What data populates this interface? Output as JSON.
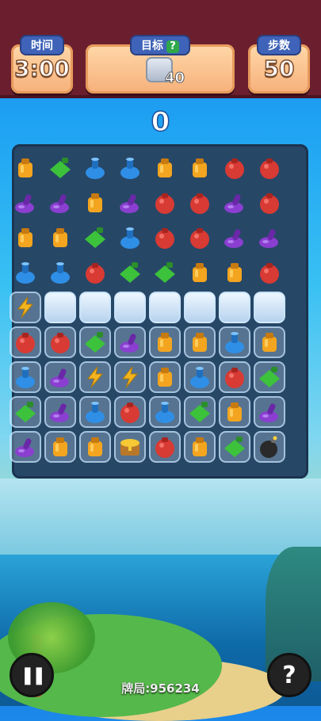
{
  "hud": {
    "time_label": "时间",
    "time_value": "3:00",
    "goal_label": "目标",
    "goal_help": "?",
    "goal_icon": "ice-block-icon",
    "goal_count": "40",
    "moves_label": "步数",
    "moves_value": "50"
  },
  "score": "0",
  "board": {
    "rows": [
      [
        "orange",
        "green",
        "blue",
        "blue",
        "orange",
        "orange",
        "red",
        "red"
      ],
      [
        "purple",
        "purple",
        "orange",
        "purple",
        "red",
        "red",
        "purple",
        "red"
      ],
      [
        "orange",
        "orange",
        "green",
        "blue",
        "red",
        "red",
        "purple",
        "purple"
      ],
      [
        "blue",
        "blue",
        "red",
        "green",
        "green",
        "orange",
        "orange",
        "red"
      ],
      [
        "lightning",
        "ice",
        "ice",
        "ice",
        "ice",
        "ice",
        "ice",
        "ice"
      ],
      [
        "red",
        "red",
        "green",
        "purple",
        "orange",
        "orange",
        "blue",
        "orange"
      ],
      [
        "blue",
        "purple",
        "lightning",
        "lightning",
        "orange",
        "blue",
        "red",
        "green"
      ],
      [
        "green",
        "purple",
        "blue",
        "red",
        "blue",
        "green",
        "orange",
        "purple"
      ],
      [
        "purple",
        "orange",
        "orange",
        "chest",
        "red",
        "orange",
        "green",
        "bomb"
      ]
    ],
    "ice_rows": [
      4,
      5,
      6,
      7,
      8
    ],
    "colors": {
      "red": "#d83a34",
      "orange": "#f3a51f",
      "green": "#3cc23b",
      "blue": "#2f8fe6",
      "purple": "#8a3fd0",
      "lightning": "#f3b51f",
      "chest": "#b8782c",
      "bomb": "#2a2a2a"
    }
  },
  "footer": {
    "pause_icon": "pause-icon",
    "help_icon": "help-icon",
    "help_glyph": "?",
    "pause_glyph": "❚❚",
    "deal_text": "牌局:956234"
  }
}
